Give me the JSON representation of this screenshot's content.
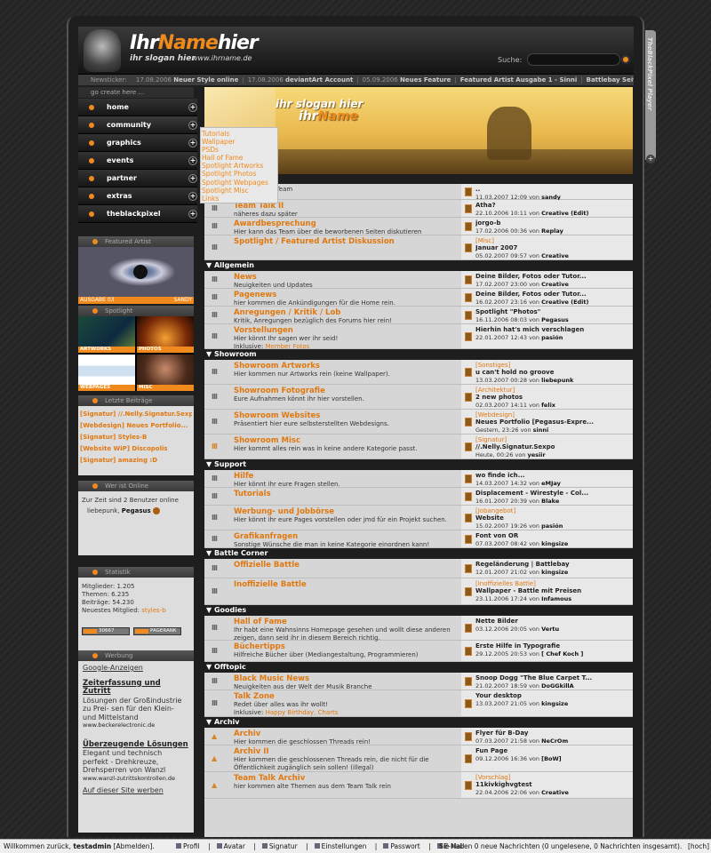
{
  "header": {
    "logo_part1": "Ihr",
    "logo_part2": "Name",
    "logo_part3": "hier",
    "slogan": "ihr slogan hier",
    "url": "www.ihrname.de",
    "search_label": "Suche:",
    "search_value": ""
  },
  "ticker": {
    "label": "Newsticker:",
    "items": [
      {
        "date": "17.08.2006",
        "text": "Neuer Style online"
      },
      {
        "date": "17.08.2006",
        "text": "deviantArt Account"
      },
      {
        "date": "05.09.2006",
        "text": "Neues Feature"
      },
      {
        "date": "",
        "text": "Featured Artist Ausgabe 1 - Sinni"
      },
      {
        "date": "",
        "text": "Battlebay Seite"
      }
    ]
  },
  "player_tab": "TheBlackPixel Player",
  "nav": {
    "heading": "go create here ...",
    "items": [
      {
        "label": "home"
      },
      {
        "label": "community"
      },
      {
        "label": "graphics"
      },
      {
        "label": "events"
      },
      {
        "label": "partner"
      },
      {
        "label": "extras"
      },
      {
        "label": "theblackpixel"
      }
    ],
    "submenu": [
      "Tutorials",
      "Wallpaper",
      "PSDs",
      "Hall of Fame",
      "Spotlight Artworks",
      "Spotlight Photos",
      "Spotlight Webpages",
      "Spotlight Misc",
      "Links"
    ]
  },
  "banner": {
    "slogan": "ihr slogan hier",
    "name_part1": "ihr",
    "name_part2": "Name"
  },
  "featured": {
    "heading": "Featured Artist",
    "left": "AUSGABE  03",
    "right": "SANDY"
  },
  "spotlight": {
    "heading": "Spotlight",
    "cells": [
      "ARTWORKS",
      "PHOTOS",
      "WEBPAGES",
      "MISC"
    ]
  },
  "latest": {
    "heading": "Letzte Beiträge",
    "items": [
      "[Signatur] //.Nelly.Signatur.Sexpo",
      "[Webdesign] Neues Portfolio...",
      "[Signatur] Styles-B",
      "[Website WiP] Discopolis",
      "[Signatur] amazing :D"
    ]
  },
  "online": {
    "heading": "Wer ist Online",
    "text": "Zur Zeit sind 2 Benutzer online",
    "user1": "liebepunk,",
    "user2": "Pegasus"
  },
  "stats": {
    "heading": "Statistik",
    "members": "Mitglieder: 1.205",
    "threads": "Themen: 6.235",
    "posts": "Beiträge: 54.230",
    "newest_label": "Neuestes Mitglied:",
    "newest": "styles-b",
    "badge1": "30667",
    "badge2": "PAGERANK"
  },
  "ads": {
    "heading": "Werbung",
    "google": "Google-Anzeigen",
    "ad1_title": "Zeiterfassung und Zutritt",
    "ad1_text": "Lösungen der Großindustrie zu Prei- sen für den Klein- und Mittelstand",
    "ad1_url": "www.beckerelectronic.de",
    "ad2_title": "Überzeugende Lösungen",
    "ad2_text": "Elegant und technisch perfekt - Drehkreuze, Drehsperren von Wanzl",
    "ad2_url": "www.wanzl-zutrittskontrollen.de",
    "ad_link": "Auf dieser Site werben"
  },
  "forum": {
    "sections": [
      {
        "name": "",
        "rows": [
          {
            "title": "",
            "desc": "Hier tagt das Team",
            "lp_prefix": "",
            "lp_title": "..",
            "lp_date": "11.03.2007 12:09 von",
            "lp_user": "sandy",
            "h": 18
          },
          {
            "title": "Team Talk II",
            "desc": "näheres dazu später",
            "lp_prefix": "",
            "lp_title": "Atha?",
            "lp_date": "22.10.2006 10:11 von",
            "lp_user": "Creative (Edit)",
            "h": 20
          },
          {
            "title": "Awardbesprechung",
            "desc": "Hier kann das Team über die beworbenen Seiten diskutieren",
            "lp_prefix": "",
            "lp_title": "jorgo-b",
            "lp_date": "17.02.2006 00:36 von",
            "lp_user": "Replay",
            "h": 20
          },
          {
            "title": "Spotlight / Featured Artist Diskussion",
            "desc": "",
            "lp_prefix": "[Misc]",
            "lp_title": "Januar 2007",
            "lp_date": "05.02.2007 09:57 von",
            "lp_user": "Creative",
            "h": 28
          }
        ]
      },
      {
        "name": "Allgemein",
        "rows": [
          {
            "title": "News",
            "desc": "Neuigkeiten und Updates",
            "lp_prefix": "",
            "lp_title": "Deine Bilder, Fotos oder Tutor...",
            "lp_date": "17.02.2007 23:00 von",
            "lp_user": "Creative",
            "h": 20
          },
          {
            "title": "Pagenews",
            "desc": "hier kommen die Ankündigungen für die Home rein.",
            "lp_prefix": "",
            "lp_title": "Deine Bilder, Fotos oder Tutor...",
            "lp_date": "16.02.2007 23:16 von",
            "lp_user": "Creative (Edit)",
            "h": 20
          },
          {
            "title": "Anregungen / Kritik / Lob",
            "desc": "Kritik, Anregungen bezüglich des Forums hier rein!",
            "lp_prefix": "",
            "lp_title": "Spotlight \"Photos\"",
            "lp_date": "16.11.2006 08:03 von",
            "lp_user": "Pegasus",
            "h": 20
          },
          {
            "title": "Vorstellungen",
            "desc": "Hier könnt Ihr sagen wer ihr seid!",
            "desc2_label": "Inklusive:",
            "desc2": "Member Fotos",
            "lp_prefix": "",
            "lp_title": "Hierhin hat's mich verschlagen",
            "lp_date": "22.01.2007 12:43 von",
            "lp_user": "pasión",
            "h": 28
          }
        ]
      },
      {
        "name": "Showroom",
        "rows": [
          {
            "title": "Showroom Artworks",
            "desc": "Hier kommen nur Artworks rein (keine Wallpaper).",
            "lp_prefix": "[Sonstiges]",
            "lp_title": "u can't hold no groove",
            "lp_date": "13.03.2007 00:28 von",
            "lp_user": "liebepunk",
            "h": 28
          },
          {
            "title": "Showroom Fotografie",
            "desc": "Eure Aufnahmen könnt ihr hier vorstellen.",
            "lp_prefix": "[Architektur]",
            "lp_title": "2 new photos",
            "lp_date": "02.03.2007 14:11 von",
            "lp_user": "felix",
            "h": 28
          },
          {
            "title": "Showroom Websites",
            "desc": "Präsentiert hier eure selbsterstellten Webdesigns.",
            "lp_prefix": "[Webdesign]",
            "lp_title": "Neues Portfolio [Pegasus-Expre...",
            "lp_date": "Gestern, 23:26 von",
            "lp_user": "sinni",
            "h": 28
          },
          {
            "title": "Showroom Misc",
            "desc": "Hier kommt alles rein was in keine andere Kategorie passt.",
            "lp_prefix": "[Signatur]",
            "lp_title": "//.Nelly.Signatur.Sexpo",
            "lp_date": "Heute, 00:26 von",
            "lp_user": "yesiir",
            "h": 28,
            "orange": true
          }
        ]
      },
      {
        "name": "Support",
        "rows": [
          {
            "title": "Hilfe",
            "desc": "Hier könnt ihr eure Fragen stellen.",
            "lp_prefix": "",
            "lp_title": "wo finde ich...",
            "lp_date": "14.03.2007 14:32 von",
            "lp_user": "eMJay",
            "h": 20
          },
          {
            "title": "Tutorials",
            "desc": "",
            "lp_prefix": "",
            "lp_title": "Displacement - Wirestyle - Col...",
            "lp_date": "16.01.2007 20:39 von",
            "lp_user": "Blake",
            "h": 20
          },
          {
            "title": "Werbung- und Jobbörse",
            "desc": "Hier könnt ihr eure Pages vorstellen oder jmd für ein Projekt suchen.",
            "lp_prefix": "[Jobangebot]",
            "lp_title": "Website",
            "lp_date": "15.02.2007 19:26 von",
            "lp_user": "pasión",
            "h": 28
          },
          {
            "title": "Grafikanfragen",
            "desc": "Sonstige Wünsche die man in keine Kategorie einordnen kann!",
            "lp_prefix": "",
            "lp_title": "Font von OR",
            "lp_date": "07.03.2007 08:42 von",
            "lp_user": "kingsize",
            "h": 20
          }
        ]
      },
      {
        "name": "Battle Corner",
        "rows": [
          {
            "title": "Offizielle Battle",
            "desc": "",
            "lp_prefix": "",
            "lp_title": "Regeländerung | Battlebay",
            "lp_date": "12.01.2007 21:02 von",
            "lp_user": "kingsize",
            "h": 22
          },
          {
            "title": "Inoffizielle Battle",
            "desc": "",
            "lp_prefix": "[Inoffizielles Battle]",
            "lp_title": "Wallpaper - Battle mit Preisen",
            "lp_date": "23.11.2006 17:24 von",
            "lp_user": "Infamous",
            "h": 30
          }
        ]
      },
      {
        "name": "Goodies",
        "rows": [
          {
            "title": "Hall of Fame",
            "desc": "Ihr habt eine Wahnsinns Homepage gesehen und wollt diese anderen zeigen, dann seid ihr in diesem Bereich richtig.",
            "lp_prefix": "",
            "lp_title": "Nette Bilder",
            "lp_date": "03.12.2006 20:05 von",
            "lp_user": "Vertu",
            "h": 28
          },
          {
            "title": "Büchertipps",
            "desc": "Hilfreiche Bücher über (Mediangestaltung, Programmieren)",
            "lp_prefix": "",
            "lp_title": "Erste Hilfe in Typografie",
            "lp_date": "29.12.2005 20:53 von",
            "lp_user": "[ Chef Koch ]",
            "h": 24
          }
        ]
      },
      {
        "name": "Offtopic",
        "rows": [
          {
            "title": "Black Music News",
            "desc": "Neuigkeiten aus der Welt der Musik Branche",
            "lp_prefix": "",
            "lp_title": "Snoop Dogg \"The Blue Carpet T...",
            "lp_date": "21.02.2007 18:59 von",
            "lp_user": "DoGGkillA",
            "h": 20
          },
          {
            "title": "Talk Zone",
            "desc": "Redet über alles was ihr wollt!",
            "desc2_label": "Inklusive:",
            "desc2": "Happy Birthday, Charts",
            "lp_prefix": "",
            "lp_title": "Your desktop",
            "lp_date": "13.03.2007 21:05 von",
            "lp_user": "kingsize",
            "h": 30
          }
        ]
      },
      {
        "name": "Archiv",
        "rows": [
          {
            "title": "Archiv",
            "desc": "Hier kommen die geschlossen Threads rein!",
            "lp_prefix": "",
            "lp_title": "Flyer für B-Day",
            "lp_date": "07.03.2007 21:58 von",
            "lp_user": "NeCrOm",
            "h": 20,
            "lock": true
          },
          {
            "title": "Archiv II",
            "desc": "Hier kommen die geschlossenen Threads rein, die nicht für die Öffentlichkeit zugänglich sein sollen! (illegal)",
            "lp_prefix": "",
            "lp_title": "Fun Page",
            "lp_date": "09.12.2006 16:36 von",
            "lp_user": "[BoW]",
            "h": 30,
            "lock": true
          },
          {
            "title": "Team Talk Archiv",
            "desc": "hier kommen alte Themen aus dem Team Talk rein",
            "lp_prefix": "[Vorschlag]",
            "lp_title": "11kivkighvgtest",
            "lp_date": "22.04.2006 22:06 von",
            "lp_user": "Creative",
            "h": 30,
            "lock": true
          }
        ]
      }
    ]
  },
  "statusbar": {
    "welcome": "Willkommen zurück,",
    "user": "testadmin",
    "logout": "[Abmelden].",
    "links": [
      "Profil",
      "Avatar",
      "Signatur",
      "Einstellungen",
      "Passwort",
      "E-Mail"
    ],
    "messages": "Sie haben 0 neue Nachrichten (0 ungelesene, 0 Nachrichten insgesamt).",
    "up": "[hoch]"
  }
}
